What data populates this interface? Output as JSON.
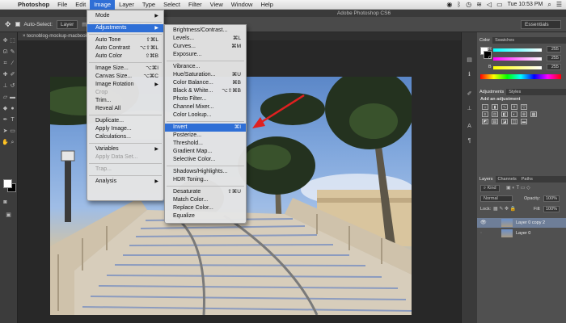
{
  "menubar": {
    "app": "Photoshop",
    "items": [
      "File",
      "Edit",
      "Image",
      "Layer",
      "Type",
      "Select",
      "Filter",
      "View",
      "Window",
      "Help"
    ],
    "active": "Image",
    "clock": "Tue 10:53 PM"
  },
  "titlebar": {
    "title": "Adobe Photoshop CS6"
  },
  "options": {
    "auto_select": "Auto-Select:",
    "layer_dd": "Layer",
    "workspace": "Essentials"
  },
  "document": {
    "tab": "tecnoblog-mockup-macbook.psd @"
  },
  "image_menu": [
    {
      "label": "Mode",
      "arrow": "▶"
    },
    {
      "sep": true
    },
    {
      "label": "Adjustments",
      "arrow": "▶",
      "highlight": true
    },
    {
      "sep": true
    },
    {
      "label": "Auto Tone",
      "shortcut": "⇧⌘L"
    },
    {
      "label": "Auto Contrast",
      "shortcut": "⌥⇧⌘L"
    },
    {
      "label": "Auto Color",
      "shortcut": "⇧⌘B"
    },
    {
      "sep": true
    },
    {
      "label": "Image Size...",
      "shortcut": "⌥⌘I"
    },
    {
      "label": "Canvas Size...",
      "shortcut": "⌥⌘C"
    },
    {
      "label": "Image Rotation",
      "arrow": "▶"
    },
    {
      "label": "Crop",
      "disabled": true
    },
    {
      "label": "Trim..."
    },
    {
      "label": "Reveal All"
    },
    {
      "sep": true
    },
    {
      "label": "Duplicate..."
    },
    {
      "label": "Apply Image..."
    },
    {
      "label": "Calculations..."
    },
    {
      "sep": true
    },
    {
      "label": "Variables",
      "arrow": "▶"
    },
    {
      "label": "Apply Data Set...",
      "disabled": true
    },
    {
      "sep": true
    },
    {
      "label": "Trap...",
      "disabled": true
    },
    {
      "sep": true
    },
    {
      "label": "Analysis",
      "arrow": "▶"
    }
  ],
  "adjustments_menu": [
    {
      "label": "Brightness/Contrast..."
    },
    {
      "label": "Levels...",
      "shortcut": "⌘L"
    },
    {
      "label": "Curves...",
      "shortcut": "⌘M"
    },
    {
      "label": "Exposure..."
    },
    {
      "sep": true
    },
    {
      "label": "Vibrance..."
    },
    {
      "label": "Hue/Saturation...",
      "shortcut": "⌘U"
    },
    {
      "label": "Color Balance...",
      "shortcut": "⌘B"
    },
    {
      "label": "Black & White...",
      "shortcut": "⌥⇧⌘B"
    },
    {
      "label": "Photo Filter..."
    },
    {
      "label": "Channel Mixer..."
    },
    {
      "label": "Color Lookup..."
    },
    {
      "sep": true
    },
    {
      "label": "Invert",
      "shortcut": "⌘I",
      "highlight": true
    },
    {
      "label": "Posterize..."
    },
    {
      "label": "Threshold..."
    },
    {
      "label": "Gradient Map..."
    },
    {
      "label": "Selective Color..."
    },
    {
      "sep": true
    },
    {
      "label": "Shadows/Highlights..."
    },
    {
      "label": "HDR Toning..."
    },
    {
      "sep": true
    },
    {
      "label": "Desaturate",
      "shortcut": "⇧⌘U"
    },
    {
      "label": "Match Color..."
    },
    {
      "label": "Replace Color..."
    },
    {
      "label": "Equalize"
    }
  ],
  "color_panel": {
    "tabs": [
      "Color",
      "Swatches"
    ],
    "channels": [
      {
        "label": "R",
        "value": "255"
      },
      {
        "label": "G",
        "value": "255"
      },
      {
        "label": "B",
        "value": "255"
      }
    ]
  },
  "adjustments_panel": {
    "tabs": [
      "Adjustments",
      "Styles"
    ],
    "heading": "Add an adjustment"
  },
  "layers_panel": {
    "tabs": [
      "Layers",
      "Channels",
      "Paths"
    ],
    "kind": "Kind",
    "blend": "Normal",
    "opacity_label": "Opacity:",
    "opacity": "100%",
    "lock_label": "Lock:",
    "fill_label": "Fill:",
    "fill": "100%",
    "layers": [
      {
        "name": "Layer 0 copy 2",
        "selected": true,
        "visible": true
      },
      {
        "name": "Layer 0",
        "selected": false,
        "visible": false
      }
    ]
  },
  "colors": {
    "highlight": "#2f6fd6",
    "arrow": "#e02020"
  }
}
